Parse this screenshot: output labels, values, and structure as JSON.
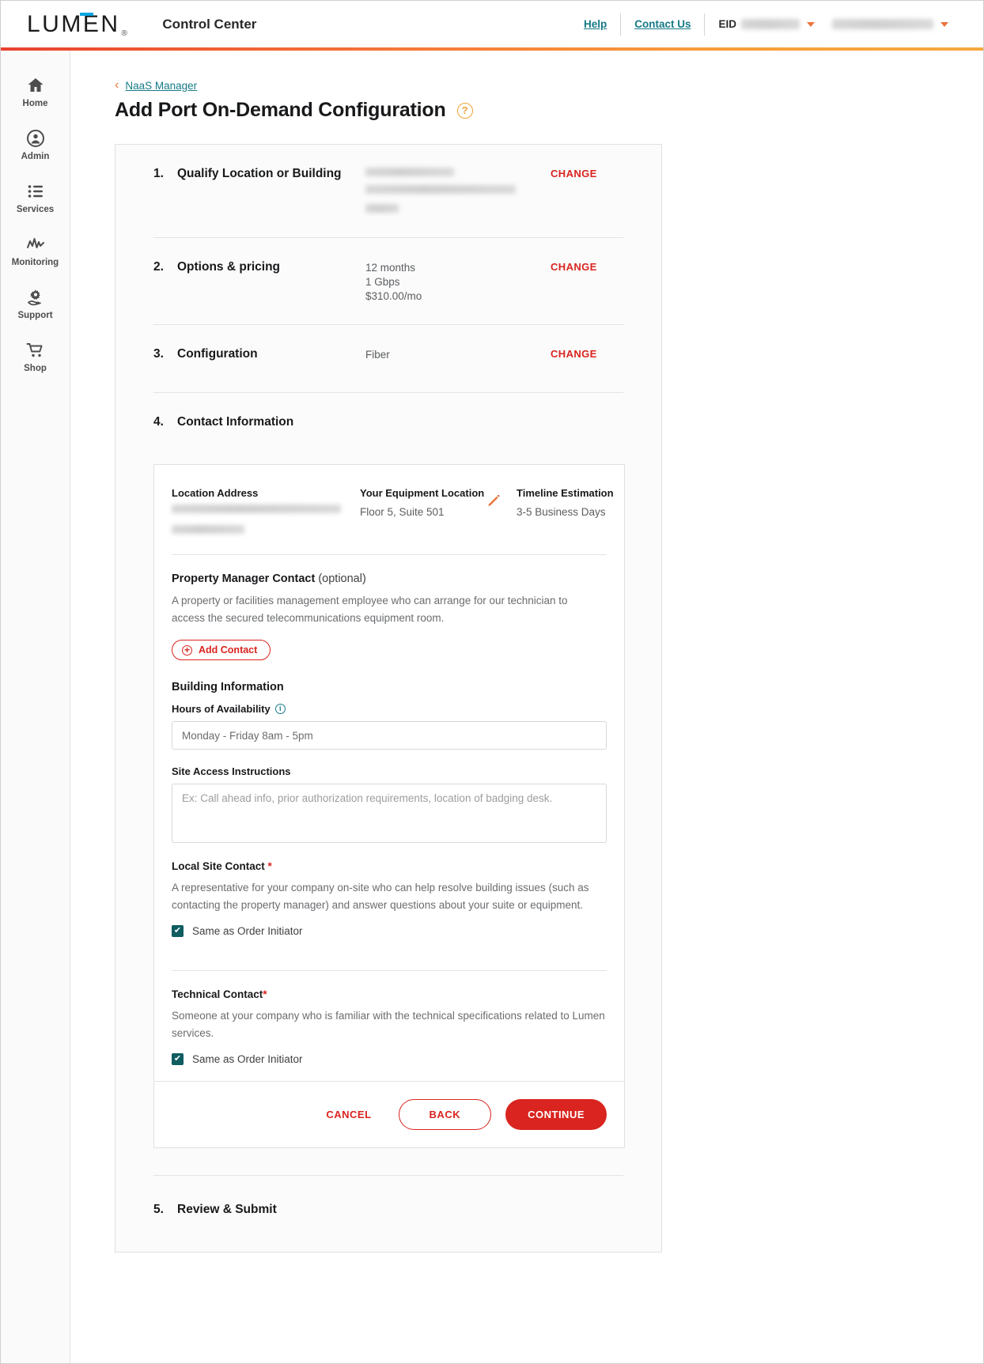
{
  "header": {
    "logo_text": "LUM",
    "logo_text2": "EN",
    "registered_mark": "®",
    "app_title": "Control Center",
    "help_label": "Help",
    "contact_us_label": "Contact Us",
    "eid_label": "EID",
    "accent_colors": {
      "brand_red": "#d9241f",
      "brand_orange": "#e8743b",
      "logo_blue": "#0aa5e0",
      "link_teal": "#157a87",
      "checkbox_teal": "#0f5c61"
    }
  },
  "sidebar": {
    "items": [
      {
        "label": "Home",
        "icon": "home-icon"
      },
      {
        "label": "Admin",
        "icon": "user-circle-icon"
      },
      {
        "label": "Services",
        "icon": "list-icon"
      },
      {
        "label": "Monitoring",
        "icon": "pulse-icon"
      },
      {
        "label": "Support",
        "icon": "gear-hand-icon"
      },
      {
        "label": "Shop",
        "icon": "cart-icon"
      }
    ]
  },
  "breadcrumb": {
    "back_chevron": "‹",
    "label": "NaaS Manager"
  },
  "page": {
    "title": "Add Port On-Demand Configuration",
    "help_icon_glyph": "?"
  },
  "steps": [
    {
      "number": "1.",
      "name": "Qualify Location or Building",
      "detail_redacted": true,
      "detail_lines": [],
      "action_label": "CHANGE"
    },
    {
      "number": "2.",
      "name": "Options & pricing",
      "detail_redacted": false,
      "detail_lines": [
        "12 months",
        "1 Gbps",
        "$310.00/mo"
      ],
      "action_label": "CHANGE"
    },
    {
      "number": "3.",
      "name": "Configuration",
      "detail_redacted": false,
      "detail_lines": [
        "Fiber"
      ],
      "action_label": "CHANGE"
    },
    {
      "number": "4.",
      "name": "Contact Information",
      "detail_redacted": false,
      "detail_lines": [],
      "action_label": ""
    },
    {
      "number": "5.",
      "name": "Review & Submit",
      "detail_redacted": false,
      "detail_lines": [],
      "action_label": ""
    }
  ],
  "contact_panel": {
    "location_address_label": "Location Address",
    "location_address_redacted": true,
    "equipment_location_label": "Your Equipment Location",
    "equipment_location_value": "Floor 5, Suite 501",
    "edit_icon": "pencil-icon",
    "timeline_label": "Timeline Estimation",
    "timeline_value": "3-5 Business Days",
    "property_manager": {
      "title": "Property Manager Contact",
      "optional_suffix": "(optional)",
      "description": "A property or facilities management employee who can arrange for our technician to access the secured telecommunications equipment room.",
      "add_contact_label": "Add Contact",
      "add_contact_icon": "plus-circle-icon"
    },
    "building_information": {
      "heading": "Building Information",
      "hours_label": "Hours of Availability",
      "hours_info_icon": "info-icon",
      "hours_placeholder": "Monday - Friday 8am - 5pm",
      "hours_value": "",
      "site_access_label": "Site Access Instructions",
      "site_access_placeholder": "Ex: Call ahead info, prior authorization requirements, location of badging desk.",
      "site_access_value": ""
    },
    "local_site_contact": {
      "title": "Local Site Contact",
      "required_marker": "*",
      "description": "A representative for your company on-site who can help resolve building issues (such as contacting the property manager) and answer questions about your suite or equipment.",
      "checkbox_label": "Same as Order Initiator",
      "checkbox_checked": true,
      "check_glyph": "✔"
    },
    "technical_contact": {
      "title": "Technical Contact",
      "required_marker": "*",
      "description": "Someone at your company who is familiar with the technical specifications related to Lumen services.",
      "checkbox_label": "Same as Order Initiator",
      "checkbox_checked": true,
      "check_glyph": "✔"
    },
    "footer": {
      "cancel_label": "CANCEL",
      "back_label": "BACK",
      "continue_label": "CONTINUE"
    }
  }
}
